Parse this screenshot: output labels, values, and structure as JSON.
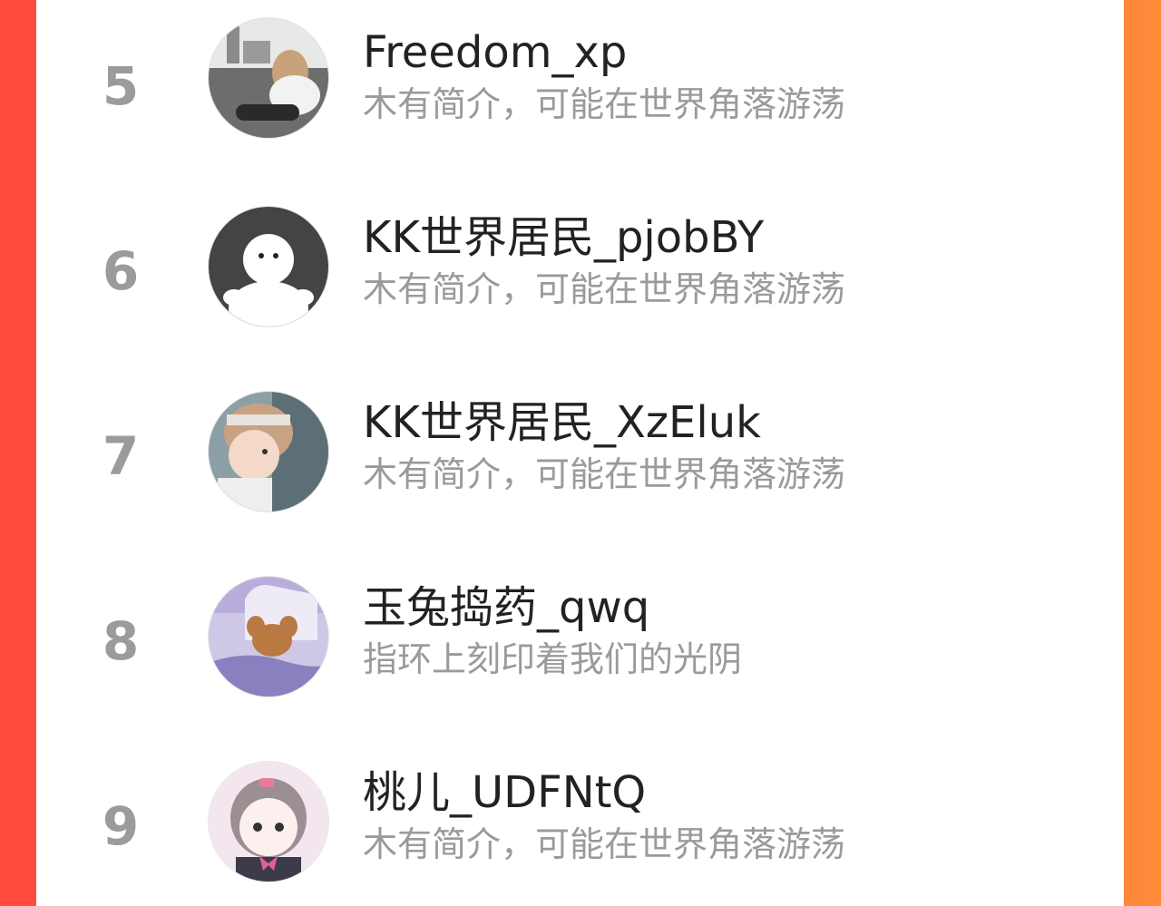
{
  "colors": {
    "background_left": "#ff4a3c",
    "background_right": "#ff8a3a",
    "panel": "#ffffff",
    "rank_text": "#9b9b9b",
    "name_text": "#222222",
    "bio_text": "#9a9a9a"
  },
  "list": {
    "items": [
      {
        "rank": "5",
        "name": "Freedom_xp",
        "bio": "木有简介，可能在世界角落游荡",
        "avatar_icon": "girl-photo-avatar"
      },
      {
        "rank": "6",
        "name": "KK世界居民_pjobBY",
        "bio": "木有简介，可能在世界角落游荡",
        "avatar_icon": "default-avatar"
      },
      {
        "rank": "7",
        "name": "KK世界居民_XzEluk",
        "bio": "木有简介，可能在世界角落游荡",
        "avatar_icon": "child-photo-avatar"
      },
      {
        "rank": "8",
        "name": "玉兔捣药_qwq",
        "bio": "指环上刻印着我们的光阴",
        "avatar_icon": "cartoon-mouse-avatar"
      },
      {
        "rank": "9",
        "name": "桃儿_UDFNtQ",
        "bio": "木有简介，可能在世界角落游荡",
        "avatar_icon": "anime-girl-avatar"
      }
    ]
  }
}
